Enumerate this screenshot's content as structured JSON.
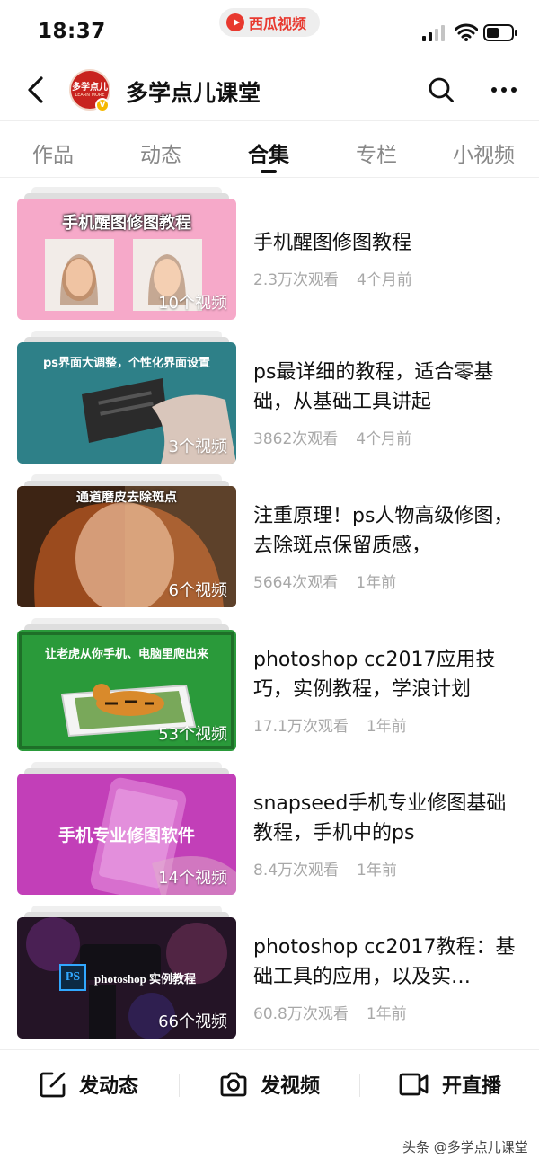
{
  "status_bar": {
    "time": "18:37",
    "app_pill": "西瓜视频"
  },
  "header": {
    "title": "多学点儿课堂",
    "avatar_text": "多学点儿",
    "avatar_sub": "LEARN MORE",
    "badge": "V"
  },
  "tabs": [
    {
      "label": "作品",
      "active": false
    },
    {
      "label": "动态",
      "active": false
    },
    {
      "label": "合集",
      "active": true
    },
    {
      "label": "专栏",
      "active": false
    },
    {
      "label": "小视频",
      "active": false
    }
  ],
  "items": [
    {
      "title": "手机醒图修图教程",
      "views": "2.3万次观看",
      "time": "4个月前",
      "count": "10个视频",
      "thumb_caption": "手机醒图修图教程"
    },
    {
      "title": "ps最详细的教程，适合零基础，从基础工具讲起",
      "views": "3862次观看",
      "time": "4个月前",
      "count": "3个视频",
      "thumb_caption": "ps界面大调整，个性化界面设置"
    },
    {
      "title": "注重原理！ps人物高级修图，去除斑点保留质感，",
      "views": "5664次观看",
      "time": "1年前",
      "count": "6个视频",
      "thumb_caption": "通道磨皮去除斑点"
    },
    {
      "title": "photoshop cc2017应用技巧，实例教程，学浪计划",
      "views": "17.1万次观看",
      "time": "1年前",
      "count": "53个视频",
      "thumb_caption": "让老虎从你手机、电脑里爬出来"
    },
    {
      "title": "snapseed手机专业修图基础教程，手机中的ps",
      "views": "8.4万次观看",
      "time": "1年前",
      "count": "14个视频",
      "thumb_caption": "手机专业修图软件"
    },
    {
      "title": "photoshop cc2017教程：基础工具的应用，以及实…",
      "views": "60.8万次观看",
      "time": "1年前",
      "count": "66个视频",
      "thumb_caption": "photoshop 实例教程",
      "thumb_logo": "PS"
    }
  ],
  "bottom_bar": {
    "post_label": "发动态",
    "video_label": "发视频",
    "live_label": "开直播"
  },
  "watermark": "头条 @多学点儿课堂"
}
